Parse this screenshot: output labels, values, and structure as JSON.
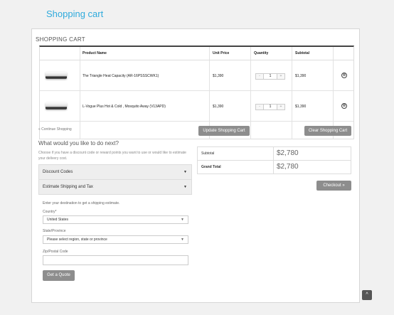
{
  "page_title": "Shopping cart",
  "section_title": "SHOPPING CART",
  "table": {
    "headers": [
      "Product Name",
      "Unit Price",
      "Quantity",
      "Subtotal"
    ],
    "rows": [
      {
        "name": "The Triangle Heat Capacity (AR-16PSSSCWK1)",
        "price": "$1,390",
        "qty": "1",
        "subtotal": "$1,390"
      },
      {
        "name": "L-Vogue Plus Hot & Cold , Mosquito Away (V13APD)",
        "price": "$1,390",
        "qty": "1",
        "subtotal": "$1,390"
      }
    ],
    "qty_minus": "-",
    "qty_plus": "+",
    "remove_icon": "⊗"
  },
  "continue_link": "« Continue Shopping",
  "update_button": "Update Shopping Cart",
  "clear_button": "Clear Shopping Cart",
  "next": {
    "heading": "What would you like to do next?",
    "hint": "Choose if you have a discount code or reward points you want to use or would like to estimate your delivery cost.",
    "discount_label": "Discount Codes",
    "shipping_label": "Estimate Shipping and Tax",
    "caret": "▼"
  },
  "totals": {
    "subtotal_label": "Subtotal",
    "subtotal_value": "$2,780",
    "grand_label": "Grand Total",
    "grand_value": "$2,780"
  },
  "checkout_button": "Checkout »",
  "shipping": {
    "intro": "Enter your destination to get a shipping estimate.",
    "country_label": "Country*",
    "country_value": "United States",
    "state_label": "State/Province",
    "state_value": "Please select region, state or province",
    "zip_label": "Zip/Postal Code",
    "zip_value": "",
    "quote_button": "Get a Quote"
  },
  "scroll_top_icon": "^"
}
